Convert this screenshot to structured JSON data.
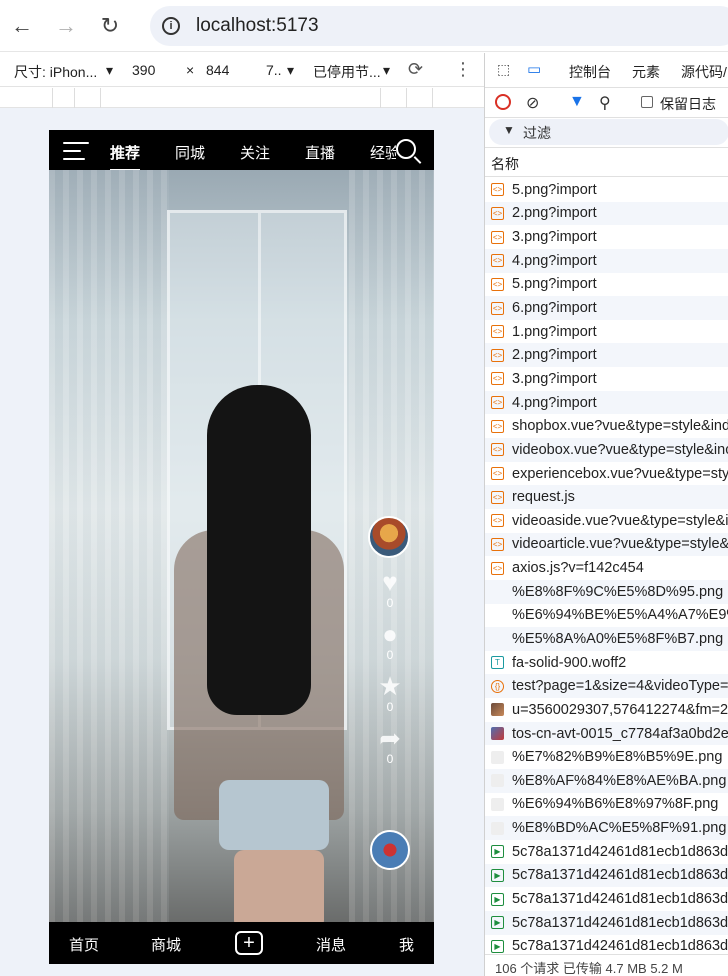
{
  "browser": {
    "url": "localhost:5173",
    "back_icon": "←",
    "forward_icon": "→",
    "reload_icon": "↻",
    "info_icon": "i"
  },
  "device_toolbar": {
    "device_label": "尺寸: iPhon...",
    "width": "390",
    "times": "×",
    "height": "844",
    "zoom": "7..",
    "throttle": "已停用节...",
    "dropdown_icon": "▾",
    "rotate_icon": "⟳",
    "more_icon": "⋮"
  },
  "app": {
    "tabs": [
      "推荐",
      "同城",
      "关注",
      "直播",
      "经验"
    ],
    "side_counts": [
      "0",
      "0",
      "0",
      "0"
    ],
    "bottom_nav": {
      "home": "首页",
      "shop": "商城",
      "plus": "+",
      "messages": "消息",
      "me": "我"
    }
  },
  "devtools": {
    "tabs": [
      "控制台",
      "元素",
      "源代码/"
    ],
    "preserve_log": "保留日志",
    "filter_label": "过滤",
    "column_name": "名称",
    "requests": [
      {
        "name": "5.png?import",
        "type": "code"
      },
      {
        "name": "2.png?import",
        "type": "code"
      },
      {
        "name": "3.png?import",
        "type": "code"
      },
      {
        "name": "4.png?import",
        "type": "code"
      },
      {
        "name": "5.png?import",
        "type": "code"
      },
      {
        "name": "6.png?import",
        "type": "code"
      },
      {
        "name": "1.png?import",
        "type": "code"
      },
      {
        "name": "2.png?import",
        "type": "code"
      },
      {
        "name": "3.png?import",
        "type": "code"
      },
      {
        "name": "4.png?import",
        "type": "code"
      },
      {
        "name": "shopbox.vue?vue&type=style&inde",
        "type": "code"
      },
      {
        "name": "videobox.vue?vue&type=style&inc",
        "type": "code"
      },
      {
        "name": "experiencebox.vue?vue&type=style",
        "type": "code"
      },
      {
        "name": "request.js",
        "type": "code"
      },
      {
        "name": "videoaside.vue?vue&type=style&i",
        "type": "code"
      },
      {
        "name": "videoarticle.vue?vue&type=style&",
        "type": "code"
      },
      {
        "name": "axios.js?v=f142c454",
        "type": "code"
      },
      {
        "name": "%E8%8F%9C%E5%8D%95.png",
        "type": "blank"
      },
      {
        "name": "%E6%94%BE%E5%A4%A7%E9%95%",
        "type": "blank"
      },
      {
        "name": "%E5%8A%A0%E5%8F%B7.png",
        "type": "blank"
      },
      {
        "name": "fa-solid-900.woff2",
        "type": "font"
      },
      {
        "name": "test?page=1&size=4&videoType=",
        "type": "fetch"
      },
      {
        "name": "u=3560029307,576412274&fm=253",
        "type": "photo"
      },
      {
        "name": "tos-cn-avt-0015_c7784af3a0bd2e7",
        "type": "photo2"
      },
      {
        "name": "%E7%82%B9%E8%B5%9E.png",
        "type": "img"
      },
      {
        "name": "%E8%AF%84%E8%AE%BA.png",
        "type": "img"
      },
      {
        "name": "%E6%94%B6%E8%97%8F.png",
        "type": "img"
      },
      {
        "name": "%E8%BD%AC%E5%8F%91.png",
        "type": "img"
      },
      {
        "name": "5c78a1371d42461d81ecb1d863de",
        "type": "media"
      },
      {
        "name": "5c78a1371d42461d81ecb1d863de",
        "type": "media"
      },
      {
        "name": "5c78a1371d42461d81ecb1d863de",
        "type": "media"
      },
      {
        "name": "5c78a1371d42461d81ecb1d863de",
        "type": "media"
      },
      {
        "name": "5c78a1371d42461d81ecb1d863de",
        "type": "media"
      }
    ],
    "status": "106 个请求   已传输 4.7 MB   5.2 M"
  }
}
